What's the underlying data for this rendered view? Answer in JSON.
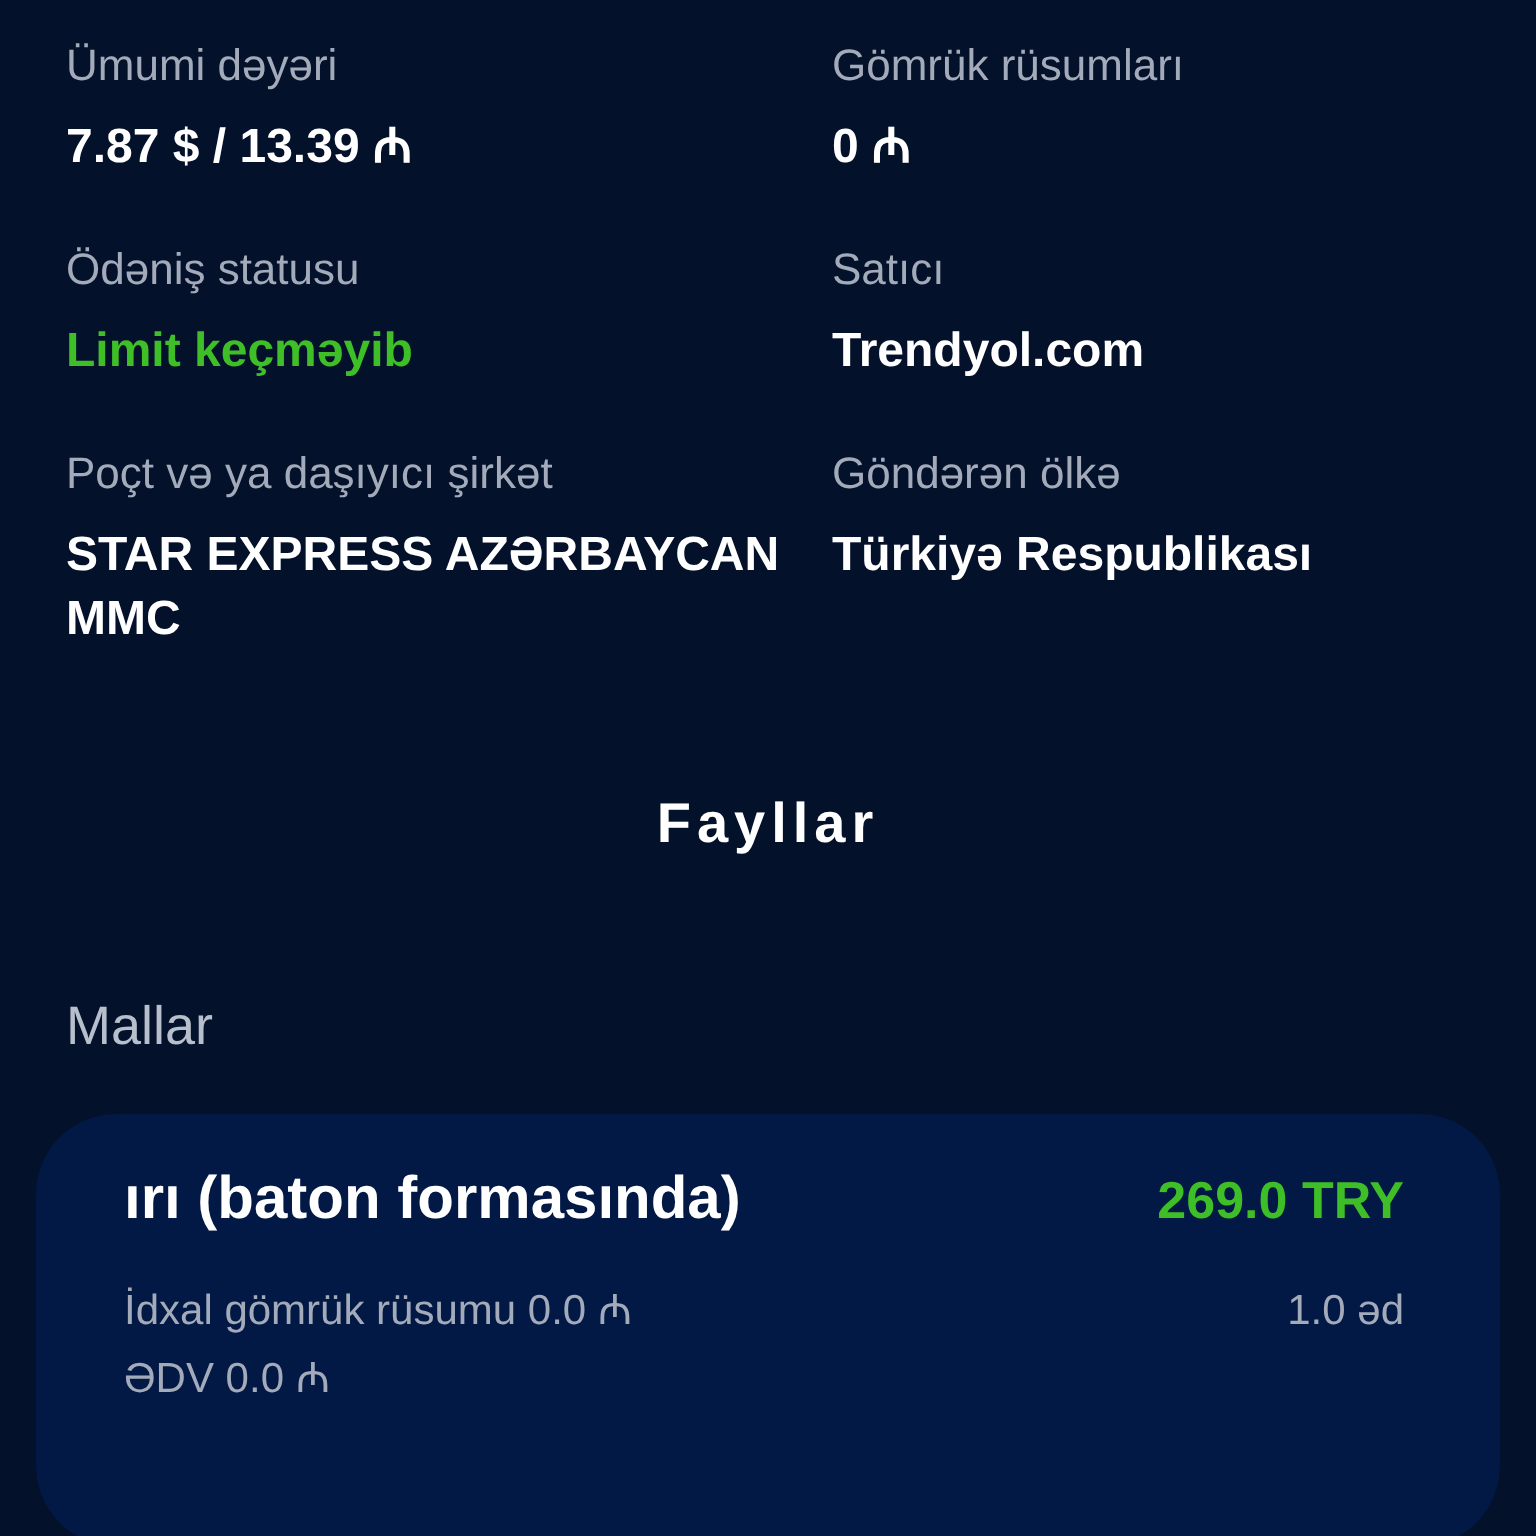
{
  "details": [
    {
      "label": "Ümumi dəyəri",
      "value": "7.87 $ / 13.39 ₼",
      "kind": "plain"
    },
    {
      "label": "Gömrük rüsumları",
      "value": "0 ₼",
      "kind": "plain"
    },
    {
      "label": "Ödəniş statusu",
      "value": "Limit keçməyib",
      "kind": "status"
    },
    {
      "label": "Satıcı",
      "value": "Trendyol.com",
      "kind": "plain"
    },
    {
      "label": "Poçt və ya daşıyıcı şirkət",
      "value": "STAR EXPRESS AZƏRBAYCAN MMC",
      "kind": "plain"
    },
    {
      "label": "Göndərən ölkə",
      "value": "Türkiyə Respublikası",
      "kind": "plain"
    }
  ],
  "files_heading": "Fayllar",
  "goods_heading": "Mallar",
  "goods": [
    {
      "name": "ırı (baton formasında)",
      "price": "269.0 TRY",
      "duty": "İdxal gömrük rüsumu 0.0 ₼",
      "quantity": "1.0 əd",
      "vat": "ƏDV 0.0 ₼"
    }
  ]
}
